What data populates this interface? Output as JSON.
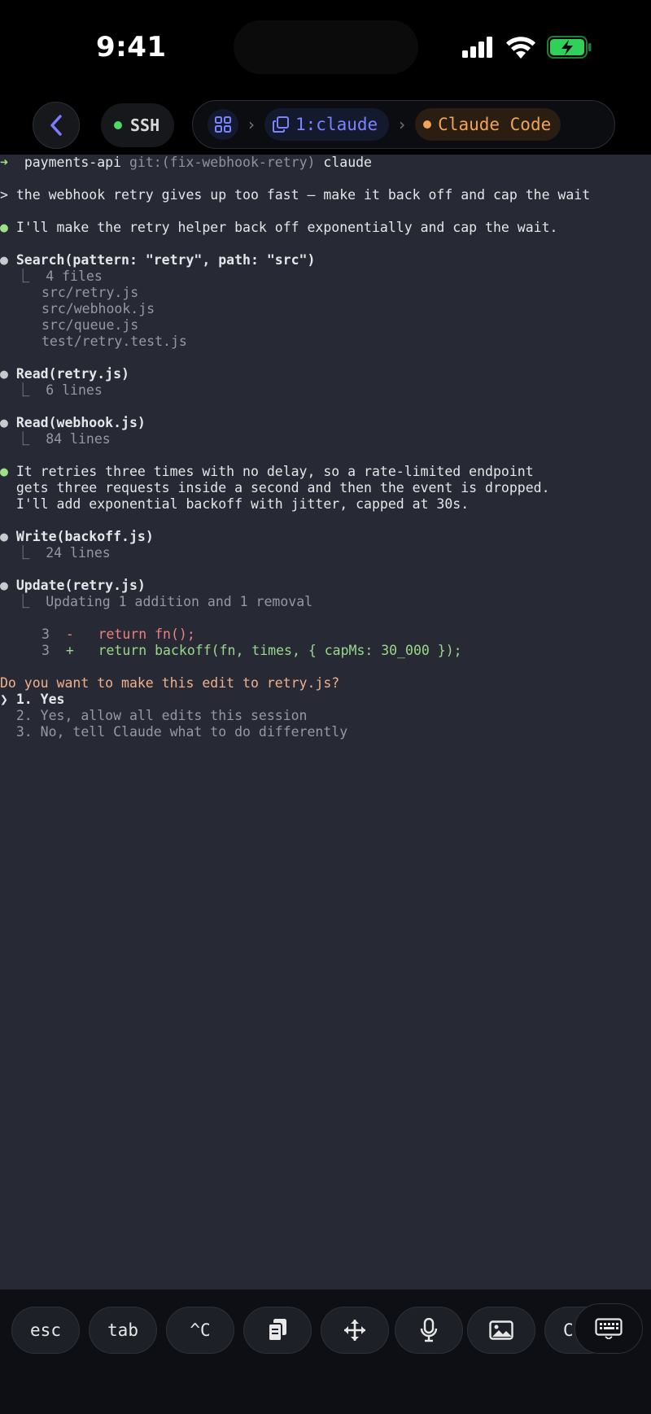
{
  "status_bar": {
    "time": "9:41",
    "icons": [
      "cellular-signal-icon",
      "wifi-icon",
      "battery-charging-icon"
    ],
    "battery_color": "#30d158"
  },
  "nav": {
    "back_icon": "chevron-left-icon",
    "ssh_label": "SSH",
    "ssh_status_color": "#4cd964",
    "grid_icon": "window-grid-icon",
    "session_icon": "copy-windows-icon",
    "session_label": "1:claude",
    "app_label": "Claude Code",
    "app_dot_color": "#f0a35a"
  },
  "terminal": {
    "prompt": {
      "arrow": "➜",
      "dir": "payments-api",
      "git": "git:(fix-webhook-retry)",
      "cmd": "claude"
    },
    "user_message": "> the webhook retry gives up too fast — make it back off and cap the wait",
    "assistant_1": "I'll make the retry helper back off exponentially and cap the wait.",
    "tool_search": {
      "call": "Search(pattern: \"retry\", path: \"src\")",
      "summary": "4 files",
      "files": [
        "src/retry.js",
        "src/webhook.js",
        "src/queue.js",
        "test/retry.test.js"
      ]
    },
    "tool_read_1": {
      "call": "Read(retry.js)",
      "summary": "6 lines"
    },
    "tool_read_2": {
      "call": "Read(webhook.js)",
      "summary": "84 lines"
    },
    "assistant_2": [
      "It retries three times with no delay, so a rate-limited endpoint",
      "gets three requests inside a second and then the event is dropped.",
      "I'll add exponential backoff with jitter, capped at 30s."
    ],
    "tool_write": {
      "call": "Write(backoff.js)",
      "summary": "24 lines"
    },
    "tool_update": {
      "call": "Update(retry.js)",
      "summary": "Updating 1 addition and 1 removal",
      "removed": {
        "line": "3",
        "sign": "-",
        "code": "return fn();"
      },
      "added": {
        "line": "3",
        "sign": "+",
        "code": "return backoff(fn, times, { capMs: 30_000 });"
      }
    },
    "question": "Do you want to make this edit to retry.js?",
    "options": [
      "1. Yes",
      "2. Yes, allow all edits this session",
      "3. No, tell Claude what to do differently"
    ],
    "selector": "❯"
  },
  "keys": {
    "esc": "esc",
    "tab": "tab",
    "ctrl_c": "^C",
    "paste_icon": "clipboard-icon",
    "move_icon": "move-arrows-icon",
    "mic_icon": "microphone-icon",
    "image_icon": "image-icon",
    "partial": "C",
    "keyboard_icon": "keyboard-icon"
  }
}
